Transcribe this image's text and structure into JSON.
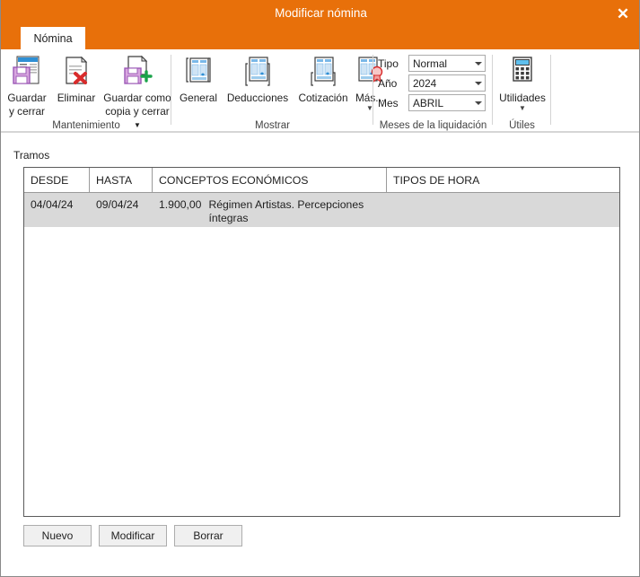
{
  "window": {
    "title": "Modificar nómina",
    "close_label": "✕"
  },
  "tabs": [
    {
      "label": "Nómina",
      "active": true
    }
  ],
  "ribbon": {
    "groups": [
      {
        "name": "mantenimiento",
        "label": "Mantenimiento",
        "items": [
          {
            "name": "guardar-y-cerrar",
            "label_line1": "Guardar",
            "label_line2": "y cerrar",
            "icon": "save-close-icon",
            "has_caret": false
          },
          {
            "name": "eliminar",
            "label_line1": "Eliminar",
            "label_line2": "",
            "icon": "delete-document-icon",
            "has_caret": false
          },
          {
            "name": "guardar-como-copia-y-cerrar",
            "label_line1": "Guardar como",
            "label_line2": "copia y cerrar",
            "icon": "save-copy-icon",
            "has_caret": true
          }
        ]
      },
      {
        "name": "mostrar",
        "label": "Mostrar",
        "items": [
          {
            "name": "general",
            "label_line1": "General",
            "label_line2": "",
            "icon": "form-general-icon",
            "has_caret": false
          },
          {
            "name": "deducciones",
            "label_line1": "Deducciones",
            "label_line2": "",
            "icon": "form-deductions-icon",
            "has_caret": false
          },
          {
            "name": "cotizacion",
            "label_line1": "Cotización",
            "label_line2": "",
            "icon": "form-contribution-icon",
            "has_caret": false
          },
          {
            "name": "mas",
            "label_line1": "Más...",
            "label_line2": "",
            "icon": "form-seal-icon",
            "has_caret": true
          }
        ]
      },
      {
        "name": "meses-de-la-liquidacion",
        "label": "Meses de la liquidación",
        "fields": [
          {
            "name": "tipo",
            "label": "Tipo",
            "value": "Normal"
          },
          {
            "name": "ano",
            "label": "Año",
            "value": "2024"
          },
          {
            "name": "mes",
            "label": "Mes",
            "value": "ABRIL"
          }
        ]
      },
      {
        "name": "utiles",
        "label": "Útiles",
        "items": [
          {
            "name": "utilidades",
            "label_line1": "Utilidades",
            "label_line2": "",
            "icon": "calculator-icon",
            "has_caret": true
          }
        ]
      }
    ]
  },
  "main": {
    "section_label": "Tramos",
    "grid": {
      "columns": [
        {
          "name": "desde",
          "label": "DESDE"
        },
        {
          "name": "hasta",
          "label": "HASTA"
        },
        {
          "name": "conceptos-economicos",
          "label": "CONCEPTOS ECONÓMICOS"
        },
        {
          "name": "tipos-de-hora",
          "label": "TIPOS DE HORA"
        }
      ],
      "rows": [
        {
          "desde": "04/04/24",
          "hasta": "09/04/24",
          "concepto_importe": "1.900,00",
          "concepto_descripcion": "Régimen Artistas. Percepciones íntegras",
          "tipos_de_hora": "",
          "selected": true
        }
      ]
    },
    "buttons": [
      {
        "name": "nuevo",
        "label": "Nuevo"
      },
      {
        "name": "modificar",
        "label": "Modificar"
      },
      {
        "name": "borrar",
        "label": "Borrar"
      }
    ]
  },
  "colors": {
    "accent": "#E8700A",
    "row_selected": "#D9D9D9",
    "border": "#5B5B5B"
  }
}
